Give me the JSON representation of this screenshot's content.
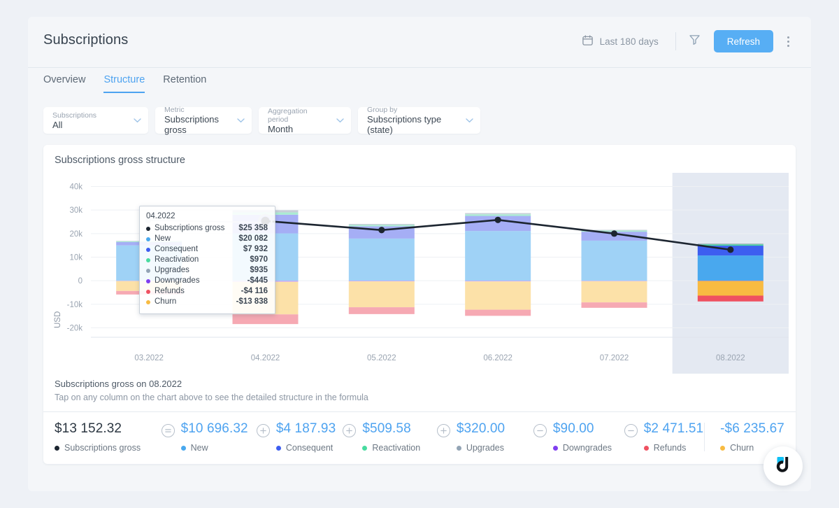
{
  "header": {
    "title": "Subscriptions",
    "date_range": "Last 180 days",
    "refresh_label": "Refresh",
    "calendar_icon": "calendar-icon",
    "filter_icon": "funnel-icon",
    "menu_icon": "kebab-menu-icon"
  },
  "tabs": [
    {
      "label": "Overview",
      "active": false
    },
    {
      "label": "Structure",
      "active": true
    },
    {
      "label": "Retention",
      "active": false
    }
  ],
  "filters": [
    {
      "label": "Subscriptions",
      "value": "All"
    },
    {
      "label": "Metric",
      "value": "Subscriptions gross"
    },
    {
      "label": "Aggregation period",
      "value": "Month"
    },
    {
      "label": "Group by",
      "value": "Subscriptions type (state)"
    }
  ],
  "card": {
    "title": "Subscriptions gross structure"
  },
  "tooltip": {
    "title": "04.2022",
    "rows": [
      {
        "name": "Subscriptions gross",
        "value": "$25 358",
        "color": "#1c2530"
      },
      {
        "name": "New",
        "value": "$20 082",
        "color": "#49a8ee"
      },
      {
        "name": "Consequent",
        "value": "$7 932",
        "color": "#3d5ef0"
      },
      {
        "name": "Reactivation",
        "value": "$970",
        "color": "#48dba0"
      },
      {
        "name": "Upgrades",
        "value": "$935",
        "color": "#93a4b5"
      },
      {
        "name": "Downgrades",
        "value": "-$445",
        "color": "#7f3ef0"
      },
      {
        "name": "Refunds",
        "value": "-$4 116",
        "color": "#ef5161"
      },
      {
        "name": "Churn",
        "value": "-$13 838",
        "color": "#f8bb42"
      }
    ]
  },
  "summary": {
    "title": "Subscriptions gross on 08.2022",
    "subtitle": "Tap on any column on the chart above to see the detailed structure in the formula",
    "items": [
      {
        "op": "",
        "amount": "$13 152.32",
        "legend": "Subscriptions gross",
        "color": "#1c2530",
        "dark": true
      },
      {
        "op": "equal",
        "amount": "$10 696.32",
        "legend": "New",
        "color": "#49a8ee",
        "dark": false
      },
      {
        "op": "plus",
        "amount": "$4 187.93",
        "legend": "Consequent",
        "color": "#3d5ef0",
        "dark": false
      },
      {
        "op": "plus",
        "amount": "$509.58",
        "legend": "Reactivation",
        "color": "#48dba0",
        "dark": false
      },
      {
        "op": "plus",
        "amount": "$320.00",
        "legend": "Upgrades",
        "color": "#93a4b5",
        "dark": false
      },
      {
        "op": "minus",
        "amount": "$90.00",
        "legend": "Downgrades",
        "color": "#7f3ef0",
        "dark": false
      },
      {
        "op": "minus",
        "amount": "$2 471.51",
        "legend": "Refunds",
        "color": "#ef5161",
        "dark": false
      },
      {
        "op": "",
        "amount": "-$6 235.67",
        "legend": "Churn",
        "color": "#f8bb42",
        "dark": false,
        "divider_before": true
      }
    ]
  },
  "fab": {
    "icon": "dashly-logo-icon",
    "accent": "#0ec0f5"
  },
  "chart_data": {
    "type": "bar",
    "title": "Subscriptions gross structure",
    "xlabel": "",
    "ylabel": "USD",
    "ylim": [
      -24000,
      44000
    ],
    "yticks": [
      40000,
      30000,
      20000,
      10000,
      0,
      -10000,
      -20000
    ],
    "ytick_labels": [
      "40k",
      "30k",
      "20k",
      "10k",
      "0",
      "-10k",
      "-20k"
    ],
    "categories": [
      "03.2022",
      "04.2022",
      "05.2022",
      "06.2022",
      "07.2022",
      "08.2022"
    ],
    "grid": true,
    "stacked": true,
    "selected_category": "08.2022",
    "hovered_category": "04.2022",
    "legend_position": "bottom",
    "series": [
      {
        "name": "New",
        "color": "#49a8ee",
        "muted": "#9fd2f6",
        "values": [
          15000,
          20082,
          17900,
          21100,
          17000,
          10696
        ]
      },
      {
        "name": "Consequent",
        "color": "#3d5ef0",
        "muted": "#a5aef5",
        "values": [
          1400,
          7932,
          5200,
          6400,
          3800,
          4188
        ]
      },
      {
        "name": "Reactivation",
        "color": "#48dba0",
        "muted": "#a9ecd2",
        "values": [
          300,
          970,
          600,
          700,
          500,
          510
        ]
      },
      {
        "name": "Upgrades",
        "color": "#93a4b5",
        "muted": "#c6cfd8",
        "values": [
          200,
          935,
          400,
          500,
          300,
          320
        ]
      },
      {
        "name": "Downgrades",
        "color": "#7f3ef0",
        "muted": "#c0a3f7",
        "values": [
          -150,
          -445,
          -260,
          -300,
          -200,
          -90
        ]
      },
      {
        "name": "Churn",
        "color": "#f8bb42",
        "muted": "#fce1a8",
        "values": [
          -4200,
          -13838,
          -11000,
          -12000,
          -9000,
          -6236
        ]
      },
      {
        "name": "Refunds",
        "color": "#ef5161",
        "muted": "#f6a9b3",
        "values": [
          -1500,
          -4116,
          -2900,
          -2600,
          -2300,
          -2472
        ]
      }
    ],
    "line": {
      "name": "Subscriptions gross",
      "color": "#1c2530",
      "values": [
        null,
        25358,
        21500,
        25800,
        20000,
        13152
      ]
    }
  }
}
